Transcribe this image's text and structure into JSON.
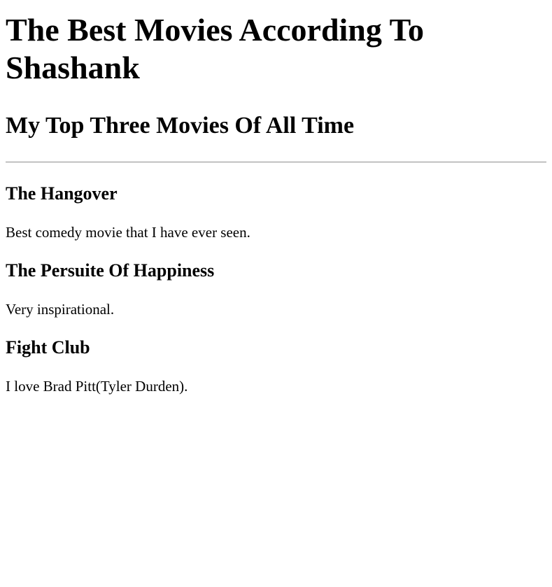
{
  "page": {
    "title": "The Best Movies According To Shashank",
    "subtitle": "My Top Three Movies Of All Time"
  },
  "movies": [
    {
      "title": "The Hangover",
      "description": "Best comedy movie that I have ever seen."
    },
    {
      "title": "The Persuite Of Happiness",
      "description": "Very inspirational."
    },
    {
      "title": "Fight Club",
      "description": "I love Brad Pitt(Tyler Durden)."
    }
  ]
}
